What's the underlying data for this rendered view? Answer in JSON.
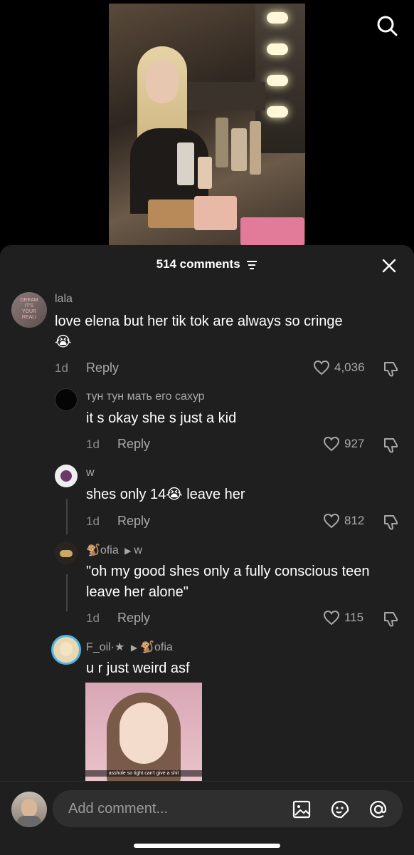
{
  "header": {
    "comment_count": "514 comments"
  },
  "comments": [
    {
      "username": "lala",
      "text": "love elena but her tik tok are always so cringe",
      "emoji": "😭",
      "age": "1d",
      "reply_label": "Reply",
      "likes": "4,036",
      "avatar_color": "#7a6a6a"
    },
    {
      "username": "тун тун мать его сахур",
      "text": "it s okay she s just a kid",
      "age": "1d",
      "reply_label": "Reply",
      "likes": "927",
      "avatar_color": "#0a0a0a"
    },
    {
      "username": "w",
      "text_before": "shes only 14",
      "emoji": "😭",
      "text_after": " leave her",
      "age": "1d",
      "reply_label": "Reply",
      "likes": "812",
      "avatar_color": "#eeeeee"
    },
    {
      "username_prefix_emoji": "🐒",
      "username": "ofia",
      "reply_to": "w",
      "text": "\"oh my good shes only a fully conscious teen leave her alone\"",
      "age": "1d",
      "reply_label": "Reply",
      "likes": "115",
      "avatar_color": "#2a2420"
    },
    {
      "username": "F_oil·★",
      "reply_to_emoji": "🐒",
      "reply_to": "ofia",
      "text": "u r just weird asf",
      "media_caption": "asshole so tight can't give a shit",
      "avatar_color": "#e8d7b0",
      "ring_color": "#4fb6e8"
    }
  ],
  "composer": {
    "placeholder": "Add comment..."
  },
  "colors": {
    "panel_bg": "#1f1f1f",
    "text_secondary": "#a8a8a8"
  },
  "icons": [
    "search-icon",
    "filter-icon",
    "close-icon",
    "heart-icon",
    "dislike-icon",
    "image-icon",
    "sticker-icon",
    "mention-icon"
  ]
}
